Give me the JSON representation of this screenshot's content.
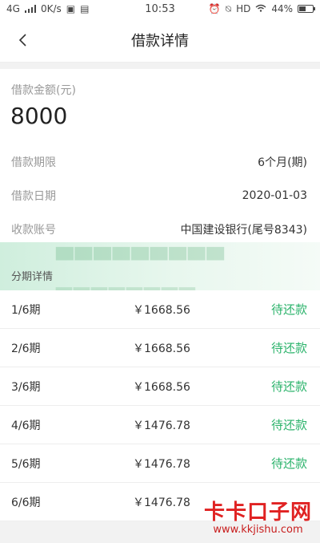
{
  "status_bar": {
    "network": "4G",
    "speed": "0K/s",
    "time": "10:53",
    "hd": "HD",
    "battery": "44%",
    "battery_level_percent": 44
  },
  "header": {
    "title": "借款详情"
  },
  "summary": {
    "amount_label": "借款金额(元)",
    "amount_value": "8000",
    "term_label": "借款期限",
    "term_value": "6个月(期)",
    "date_label": "借款日期",
    "date_value": "2020-01-03",
    "account_label": "收款账号",
    "account_value": "中国建设银行(尾号8343)"
  },
  "installments": {
    "title": "分期详情",
    "rows": [
      {
        "period": "1/6期",
        "amount": "￥1668.56",
        "status": "待还款"
      },
      {
        "period": "2/6期",
        "amount": "￥1668.56",
        "status": "待还款"
      },
      {
        "period": "3/6期",
        "amount": "￥1668.56",
        "status": "待还款"
      },
      {
        "period": "4/6期",
        "amount": "￥1476.78",
        "status": "待还款"
      },
      {
        "period": "5/6期",
        "amount": "￥1476.78",
        "status": "待还款"
      },
      {
        "period": "6/6期",
        "amount": "￥1476.78",
        "status": ""
      }
    ]
  },
  "watermark": {
    "brand": "卡卡口子网",
    "url": "www.kkjishu.com"
  },
  "colors": {
    "accent_green": "#2bb36b",
    "brand_red": "#e02222"
  }
}
